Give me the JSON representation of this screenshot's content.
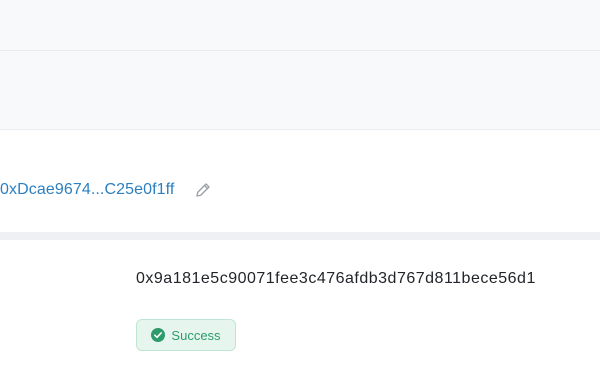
{
  "header": {},
  "account": {
    "address": "0xDcae9674...C25e0f1ff"
  },
  "transaction": {
    "hash": "0x9a181e5c90071fee3c476afdb3d767d811bece56d1",
    "status": "Success"
  },
  "icons": {
    "edit": "pencil-icon",
    "status": "check-circle-icon"
  },
  "colors": {
    "link": "#2c7fc0",
    "success_text": "#2d9b6c",
    "success_bg": "#e6f6ef",
    "success_border": "#bfe6d5"
  }
}
